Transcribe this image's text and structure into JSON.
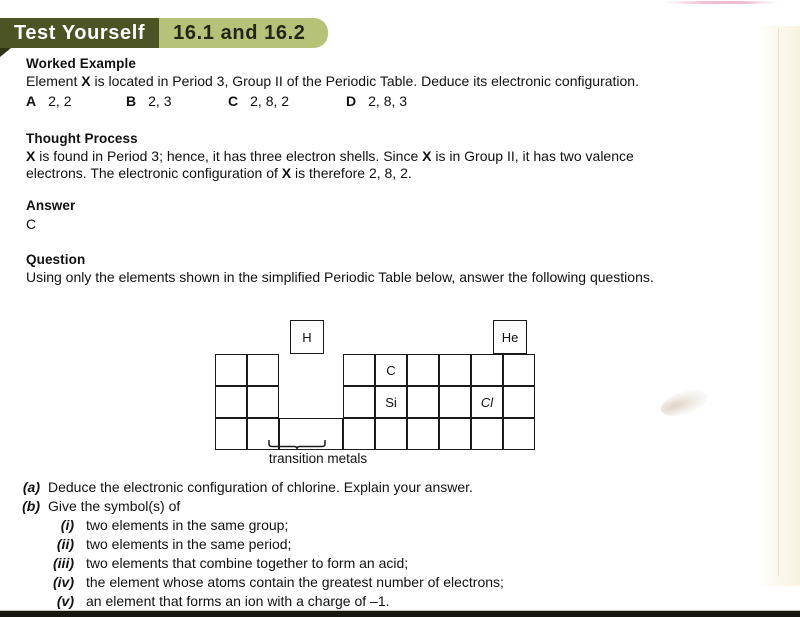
{
  "banner": {
    "title": "Test Yourself",
    "sections": "16.1 and 16.2"
  },
  "worked_example": {
    "heading": "Worked Example",
    "prompt_pre": "Element ",
    "prompt_var": "X",
    "prompt_post": " is located in Period 3, Group II of the Periodic Table. Deduce its electronic configuration.",
    "choices": [
      {
        "label": "A",
        "value": "2, 2"
      },
      {
        "label": "B",
        "value": "2, 3"
      },
      {
        "label": "C",
        "value": "2, 8, 2"
      },
      {
        "label": "D",
        "value": "2, 8, 3"
      }
    ]
  },
  "thought_process": {
    "heading": "Thought Process",
    "line1_var": "X",
    "line1_a": " is found in Period 3; hence, it has three electron shells. Since ",
    "line1_var2": "X",
    "line1_b": " is in Group II, it has two valence",
    "line2_a": "electrons. The electronic configuration of ",
    "line2_var": "X",
    "line2_b": " is therefore 2, 8, 2."
  },
  "answer": {
    "heading": "Answer",
    "value": "C"
  },
  "question": {
    "heading": "Question",
    "intro": "Using only the elements shown in the simplified Periodic Table below, answer the following questions."
  },
  "periodic_table": {
    "hydrogen_symbol": "H",
    "helium_symbol": "He",
    "carbon_symbol": "C",
    "silicon_symbol": "Si",
    "chlorine_symbol": "Cl",
    "transition_label": "transition metals",
    "left_block_columns": 2,
    "right_block_columns": 6,
    "rows": 3
  },
  "items": [
    {
      "level": 1,
      "mark": "(a)",
      "text": "Deduce the electronic configuration of chlorine. Explain your answer."
    },
    {
      "level": 1,
      "mark": "(b)",
      "text": "Give the symbol(s) of"
    },
    {
      "level": 2,
      "mark": "(i)",
      "text": "two elements in the same group;"
    },
    {
      "level": 2,
      "mark": "(ii)",
      "text": "two elements in the same period;"
    },
    {
      "level": 2,
      "mark": "(iii)",
      "text": "two elements that combine together to form an acid;"
    },
    {
      "level": 2,
      "mark": "(iv)",
      "text": "the element whose atoms contain the greatest number of electrons;"
    },
    {
      "level": 2,
      "mark": "(v)",
      "text": "an element that forms an ion with a charge of –1."
    }
  ],
  "colors": {
    "banner_dark": "#4c5426",
    "banner_light": "#b5c277",
    "banner_light_text": "#232614",
    "page_bg": "#ffffff",
    "ink": "#111111",
    "bottom_bar": "#17160f"
  }
}
